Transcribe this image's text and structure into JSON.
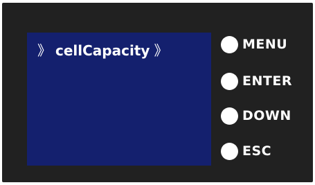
{
  "screen": {
    "left_chevron": "》",
    "title": "cellCapacity",
    "right_chevron": "》"
  },
  "keys": [
    {
      "label": "MENU"
    },
    {
      "label": "ENTER"
    },
    {
      "label": "DOWN"
    },
    {
      "label": "ESC"
    }
  ],
  "colors": {
    "panel": "#212121",
    "screen": "#14206e",
    "text": "#ffffff"
  }
}
